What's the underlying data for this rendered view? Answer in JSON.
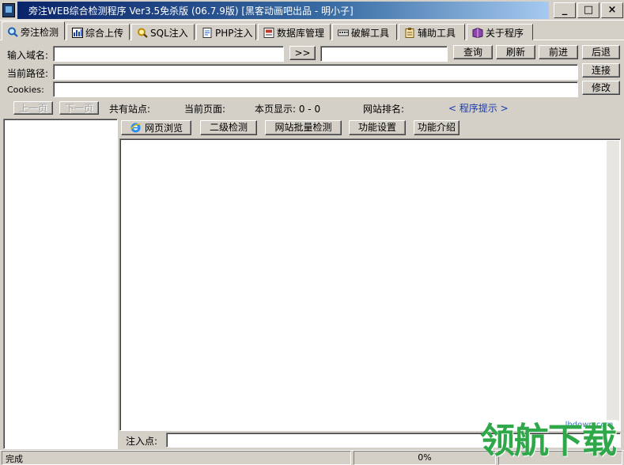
{
  "window": {
    "title": "旁注WEB综合检测程序 Ver3.5免杀版 (06.7.9版) [黑客动画吧出品 - 明小子]",
    "controls": {
      "minimize": "_",
      "maximize": "□",
      "close": "×"
    }
  },
  "tabs": [
    {
      "label": "旁注检测",
      "icon": "magnifier-icon"
    },
    {
      "label": "综合上传",
      "icon": "bar-chart-icon"
    },
    {
      "label": "SQL注入",
      "icon": "magnifier-icon"
    },
    {
      "label": "PHP注入",
      "icon": "document-icon"
    },
    {
      "label": "数据库管理",
      "icon": "database-icon"
    },
    {
      "label": "破解工具",
      "icon": "keyboard-icon"
    },
    {
      "label": "辅助工具",
      "icon": "clipboard-icon"
    },
    {
      "label": "关于程序",
      "icon": "book-icon"
    }
  ],
  "form": {
    "domain_label": "输入域名:",
    "domain_value": "",
    "go_button": ">>",
    "extra_value": "",
    "path_label": "当前路径:",
    "path_value": "",
    "cookies_label": "Cookies:",
    "cookies_value": ""
  },
  "buttons": {
    "query": "查询",
    "refresh": "刷新",
    "forward": "前进",
    "back": "后退",
    "connect": "连接",
    "modify": "修改"
  },
  "pager": {
    "prev": "上一页",
    "next": "下一页",
    "sites": "共有站点:",
    "current_page": "当前页面:",
    "shown": "本页显示: 0 - 0",
    "rank": "网站排名:",
    "hint": "< 程序提示 >"
  },
  "subtoolbar": {
    "browse": "网页浏览",
    "level2": "二级检测",
    "batch": "网站批量检测",
    "settings": "功能设置",
    "intro": "功能介绍"
  },
  "inject": {
    "label": "注入点:",
    "value": ""
  },
  "status": {
    "text": "完成",
    "progress": "0%"
  },
  "watermark": {
    "text": "领航下载",
    "url": "lhdown.com"
  }
}
